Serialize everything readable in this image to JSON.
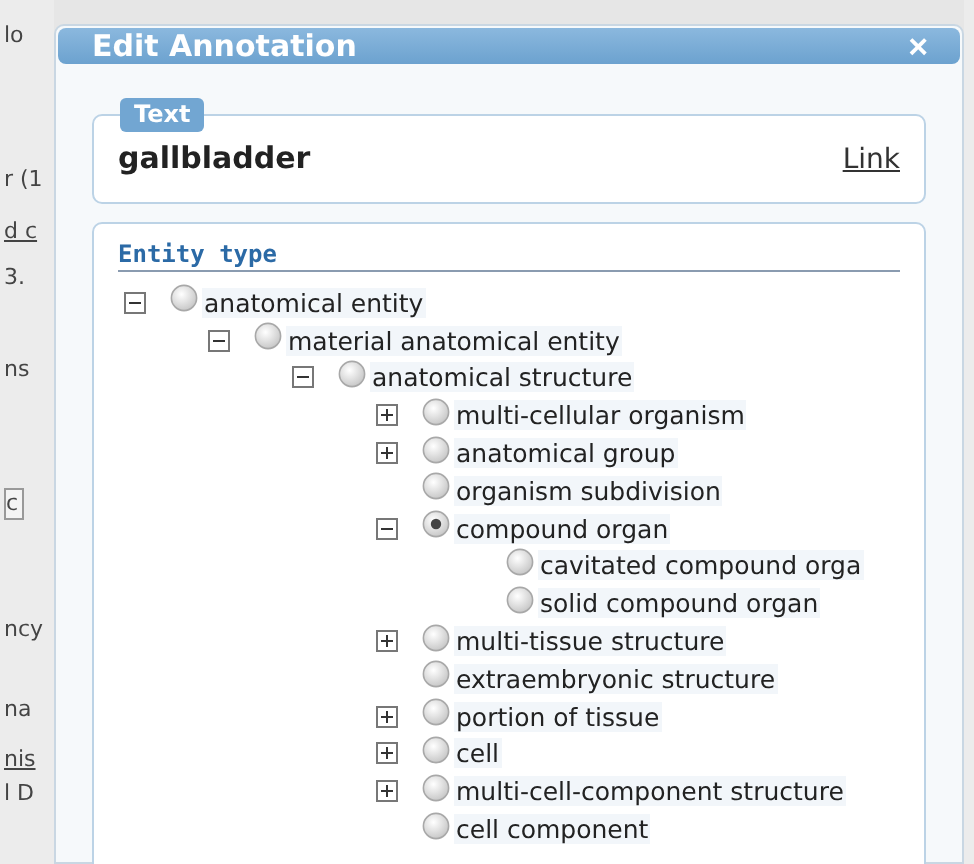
{
  "background_page": {
    "fragments": [
      "lo",
      "r (1",
      "d c",
      "3.",
      "ns",
      "c",
      "ncy",
      "na",
      "nis",
      "l D"
    ]
  },
  "dialog": {
    "title": "Edit Annotation",
    "close": "×",
    "text_section": {
      "legend": "Text",
      "value": "gallbladder",
      "link": "Link"
    },
    "entity_type": {
      "legend": "Entity type",
      "tree": [
        {
          "label": "anatomical entity",
          "expanded": true,
          "selected": false,
          "children": [
            {
              "label": "material anatomical entity",
              "expanded": true,
              "selected": false,
              "children": [
                {
                  "label": "anatomical structure",
                  "expanded": true,
                  "selected": false,
                  "children": [
                    {
                      "label": "multi-cellular organism",
                      "expanded": false,
                      "selected": false
                    },
                    {
                      "label": "anatomical group",
                      "expanded": false,
                      "selected": false
                    },
                    {
                      "label": "organism subdivision",
                      "selected": false
                    },
                    {
                      "label": "compound organ",
                      "expanded": true,
                      "selected": true,
                      "children": [
                        {
                          "label": "cavitated compound orga",
                          "selected": false
                        },
                        {
                          "label": "solid compound organ",
                          "selected": false
                        }
                      ]
                    },
                    {
                      "label": "multi-tissue structure",
                      "expanded": false,
                      "selected": false
                    },
                    {
                      "label": "extraembryonic structure",
                      "selected": false
                    },
                    {
                      "label": "portion of tissue",
                      "expanded": false,
                      "selected": false
                    },
                    {
                      "label": "cell",
                      "expanded": false,
                      "selected": false
                    },
                    {
                      "label": "multi-cell-component structure",
                      "expanded": false,
                      "selected": false
                    },
                    {
                      "label": "cell component",
                      "selected": false
                    }
                  ]
                }
              ]
            }
          ]
        }
      ]
    }
  }
}
